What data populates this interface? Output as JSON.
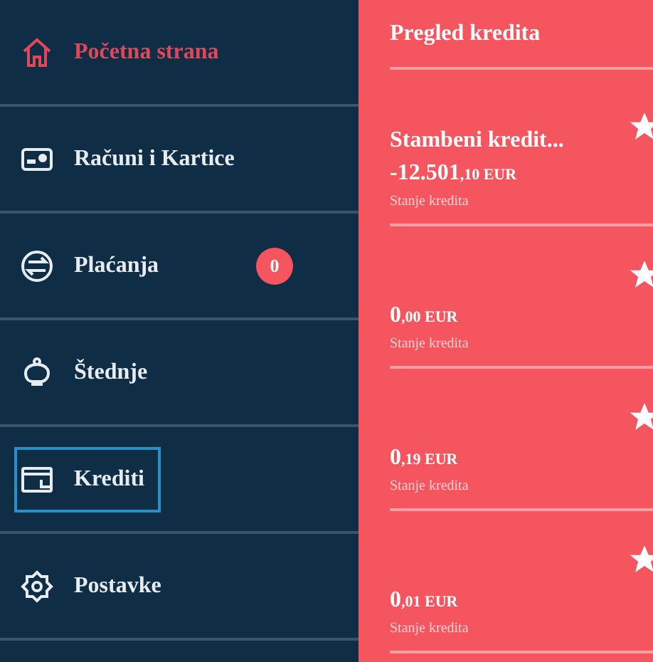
{
  "sidebar": {
    "items": [
      {
        "label": "Početna strana",
        "selected": true,
        "focused": false
      },
      {
        "label": "Računi i Kartice",
        "selected": false,
        "focused": false
      },
      {
        "label": "Plaćanja",
        "selected": false,
        "focused": false,
        "badge": "0"
      },
      {
        "label": "Štednje",
        "selected": false,
        "focused": false
      },
      {
        "label": "Krediti",
        "selected": false,
        "focused": true
      },
      {
        "label": "Postavke",
        "selected": false,
        "focused": false
      }
    ]
  },
  "panel": {
    "title": "Pregled kredita",
    "loans": [
      {
        "name": "Stambeni kredit...",
        "amount": "-12.501",
        "fraction": ",10 EUR",
        "caption": "Stanje kredita",
        "favorite": true
      },
      {
        "amount": "0",
        "fraction": ",00 EUR",
        "caption": "Stanje kredita",
        "favorite": true
      },
      {
        "amount": "0",
        "fraction": ",19 EUR",
        "caption": "Stanje kredita",
        "favorite": true
      },
      {
        "amount": "0",
        "fraction": ",01 EUR",
        "caption": "Stanje kredita",
        "favorite": true
      }
    ]
  }
}
